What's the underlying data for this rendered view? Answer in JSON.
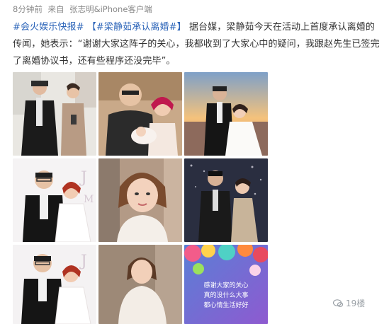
{
  "post": {
    "meta": {
      "time": "8分钟前",
      "source_prefix": "来自",
      "source": "张志明&iPhone客户端"
    },
    "topic1": "#会火娱乐快报#",
    "topic2": "【#梁静茹承认离婚#】",
    "text": "据台媒，梁静茹今天在活动上首度承认离婚的传闻，她表示：“谢谢大家这阵子的关心，我都收到了大家心中的疑问，我跟赵先生已签完了离婚协议书，还有些程序还没完毕”。",
    "images": [
      {
        "name": "photo-couple-event-white-wall"
      },
      {
        "name": "photo-man-woman-baby"
      },
      {
        "name": "photo-wedding-sunset-beach"
      },
      {
        "name": "photo-wedding-backdrop-1"
      },
      {
        "name": "photo-selfie-woman"
      },
      {
        "name": "photo-couple-formal-night"
      },
      {
        "name": "photo-wedding-backdrop-2"
      },
      {
        "name": "photo-woman-white-dress"
      },
      {
        "name": "photo-card-balloons",
        "card_text": [
          "感谢大家的关心",
          "真的没什么大事",
          "都心情生活好好"
        ]
      }
    ],
    "watermark": "19楼"
  },
  "colors": {
    "link": "#2a63b8",
    "text": "#333333",
    "meta": "#888888"
  }
}
